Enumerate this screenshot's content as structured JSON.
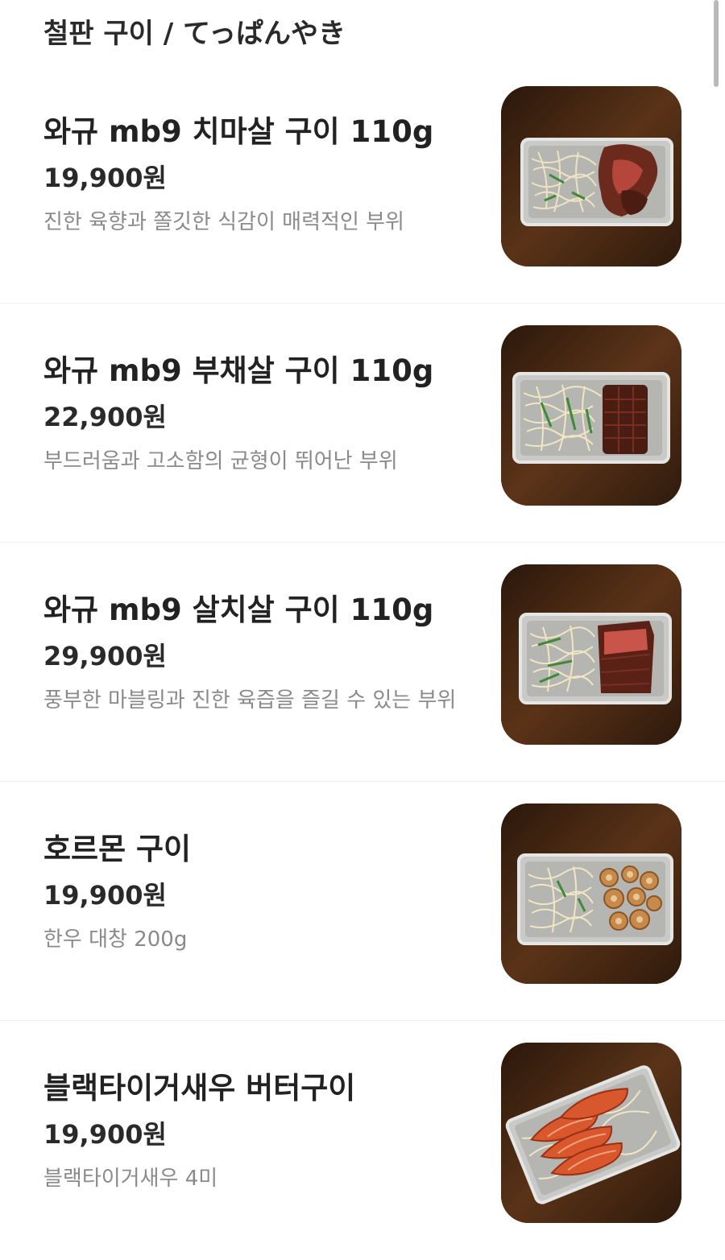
{
  "section": {
    "title": "철판 구이 / てっぱんやき"
  },
  "items": [
    {
      "name": "와규 mb9 치마살 구이 110g",
      "price": "19,900원",
      "description": "진한 육향과 쫄깃한 식감이 매력적인 부위",
      "image": "wagyu-skirt-steak-photo"
    },
    {
      "name": "와규 mb9 부채살 구이 110g",
      "price": "22,900원",
      "description": "부드러움과 고소함의 균형이 뛰어난 부위",
      "image": "wagyu-flat-iron-photo"
    },
    {
      "name": "와규 mb9 살치살 구이 110g",
      "price": "29,900원",
      "description": "풍부한 마블링과 진한 육즙을 즐길 수 있는 부위",
      "image": "wagyu-chuck-flap-photo"
    },
    {
      "name": "호르몬 구이",
      "price": "19,900원",
      "description": "한우 대창 200g",
      "image": "hormone-intestine-photo"
    },
    {
      "name": "블랙타이거새우 버터구이",
      "price": "19,900원",
      "description": "블랙타이거새우 4미",
      "image": "black-tiger-shrimp-photo"
    }
  ]
}
